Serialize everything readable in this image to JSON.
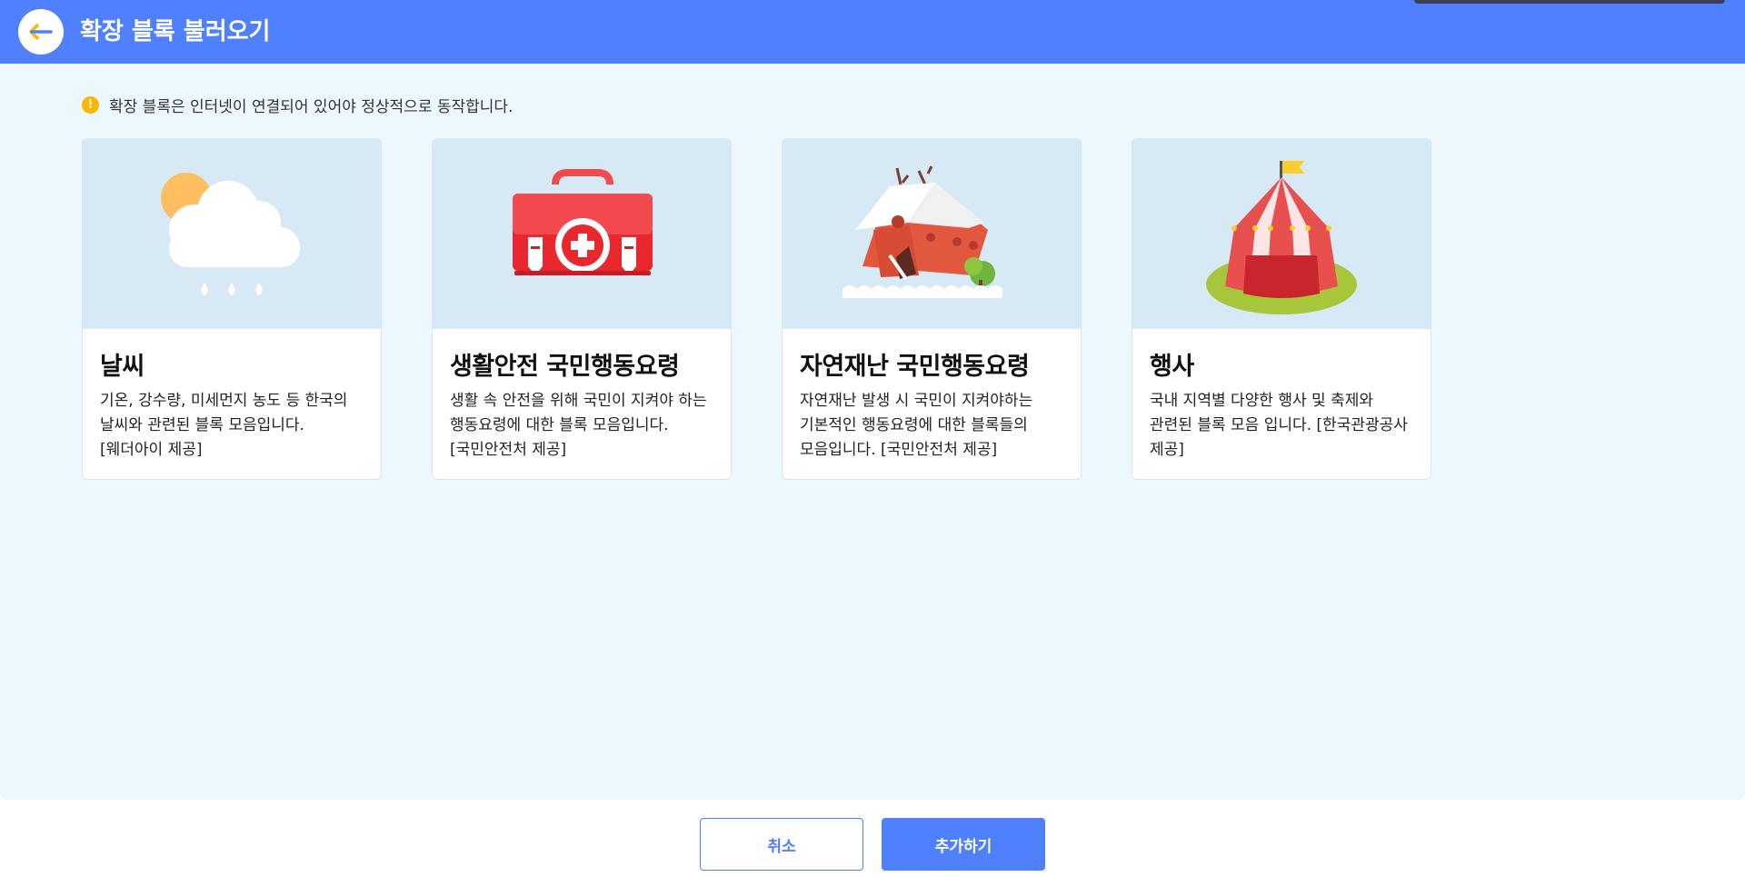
{
  "header": {
    "title": "확장 블록 불러오기"
  },
  "notice": {
    "icon_text": "!",
    "text": "확장 블록은 인터넷이 연결되어 있어야 정상적으로 동작합니다."
  },
  "cards": [
    {
      "title": "날씨",
      "desc": "기온, 강수량, 미세먼지 농도 등 한국의 날씨와 관련된 블록 모음입니다. [웨더아이 제공]",
      "icon": "weather-icon"
    },
    {
      "title": "생활안전 국민행동요령",
      "desc": "생활 속 안전을 위해 국민이 지켜야 하는 행동요령에 대한 블록 모음입니다. [국민안전처 제공]",
      "icon": "first-aid-kit-icon"
    },
    {
      "title": "자연재난 국민행동요령",
      "desc": "자연재난 발생 시 국민이 지켜야하는 기본적인 행동요령에 대한 블록들의 모음입니다. [국민안전처 제공]",
      "icon": "flooded-house-icon"
    },
    {
      "title": "행사",
      "desc": "국내 지역별 다양한 행사 및 축제와 관련된 블록 모음 입니다. [한국관광공사 제공]",
      "icon": "circus-tent-icon"
    }
  ],
  "footer": {
    "cancel_label": "취소",
    "add_label": "추가하기"
  },
  "colors": {
    "accent": "#4f80ff",
    "background": "#edf7fe",
    "card_image_bg": "#d6e9f5",
    "warning": "#ffb400"
  }
}
